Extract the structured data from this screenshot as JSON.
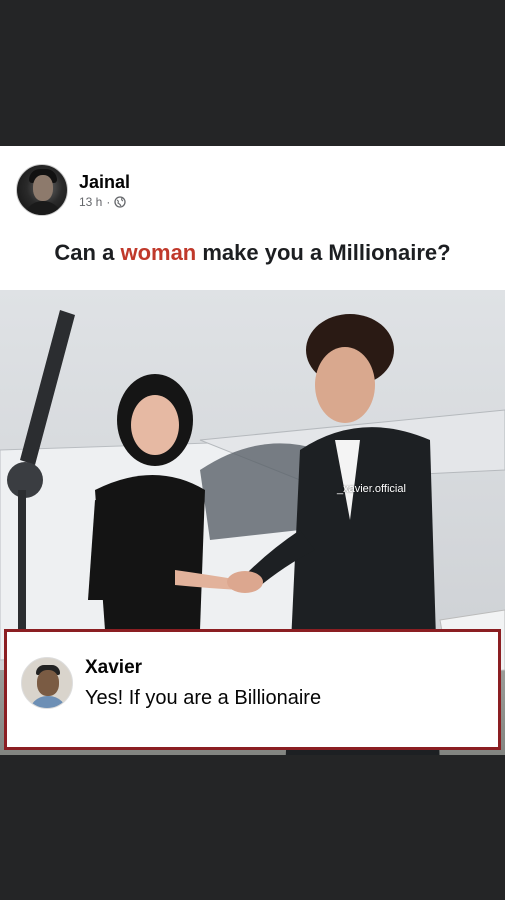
{
  "post": {
    "author": "Jainal",
    "time": "13 h",
    "dot": "·",
    "caption": {
      "before": "Can a ",
      "highlight": "woman",
      "after": " make you a Millionaire?"
    },
    "photo": {
      "watermark": "_xavier.official"
    }
  },
  "comment": {
    "name": "Xavier",
    "text": "Yes! If you are a Billionaire"
  },
  "colors": {
    "highlight": "#c0392b",
    "frame": "#8b1e22",
    "background": "#242526"
  }
}
